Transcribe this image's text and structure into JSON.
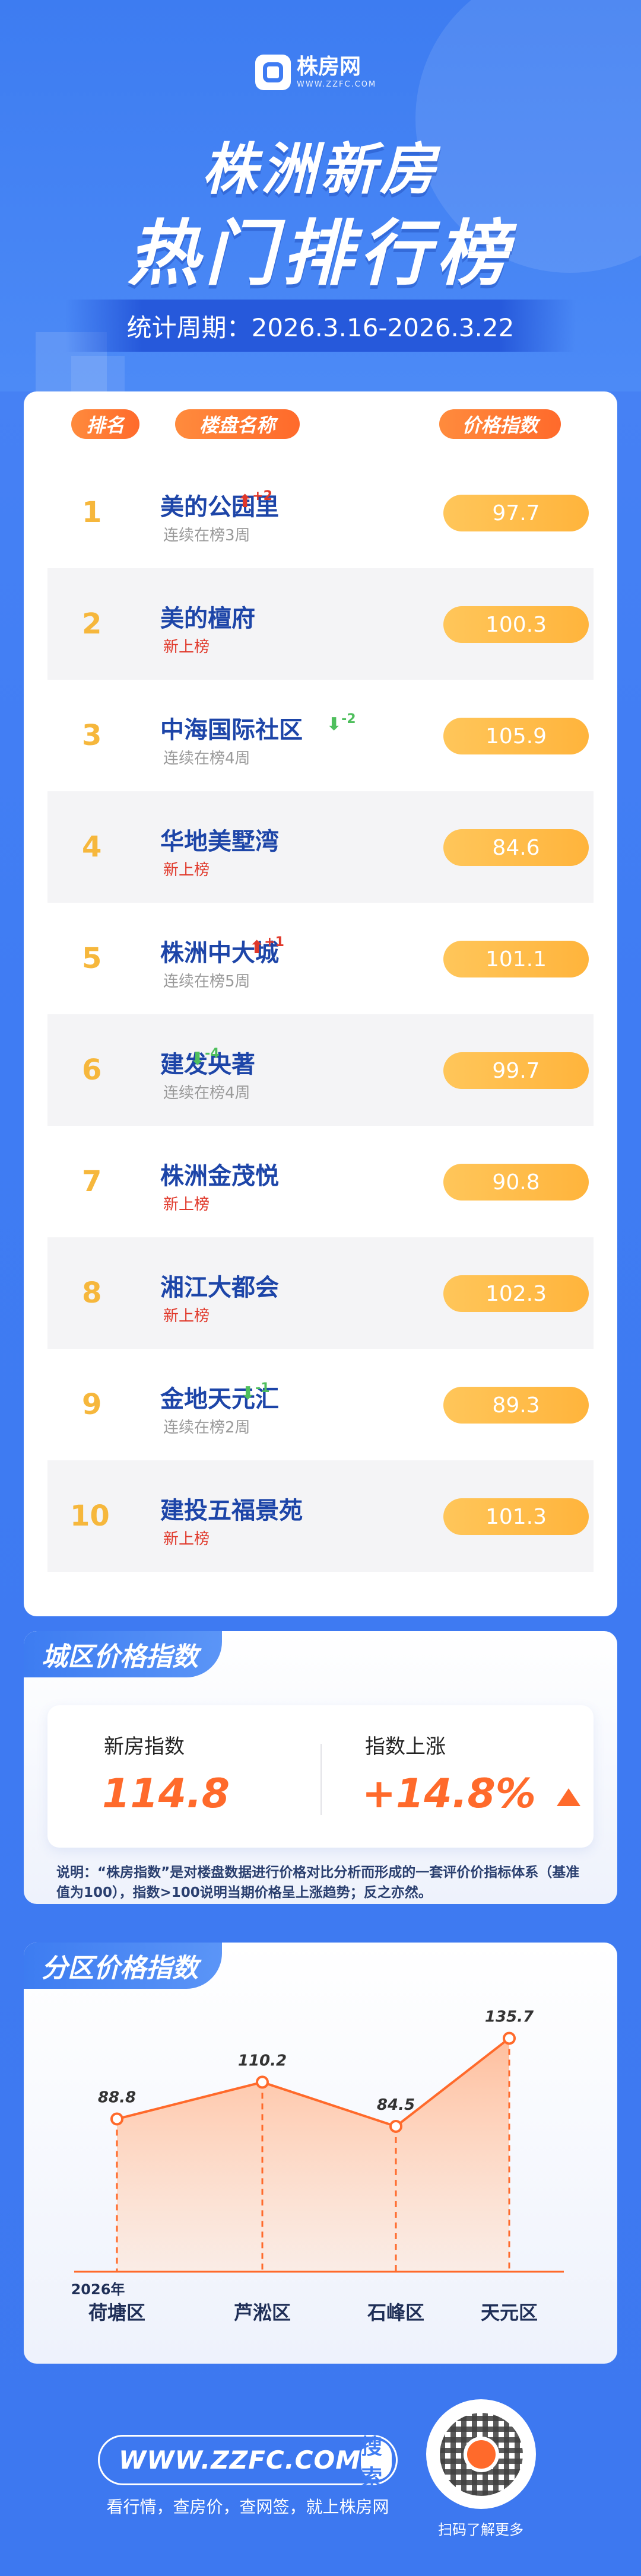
{
  "brand": {
    "name": "株房网",
    "domain": "WWW.ZZFC.COM"
  },
  "header": {
    "title_line1": "株洲新房",
    "title_line2": "热门排行榜",
    "period": "统计周期：2026.3.16-2026.3.22"
  },
  "ranking": {
    "headers": {
      "rank": "排名",
      "name": "楼盘名称",
      "price": "价格指数"
    },
    "rows": [
      {
        "rank": "1",
        "name": "美的公园里",
        "trend": "up",
        "delta": "+2",
        "status": "连续在榜3周",
        "status_type": "continuing",
        "price": "97.7"
      },
      {
        "rank": "2",
        "name": "美的檀府",
        "trend": "",
        "delta": "",
        "status": "新上榜",
        "status_type": "new",
        "price": "100.3"
      },
      {
        "rank": "3",
        "name": "中海国际社区",
        "trend": "down",
        "delta": "-2",
        "status": "连续在榜4周",
        "status_type": "continuing",
        "price": "105.9"
      },
      {
        "rank": "4",
        "name": "华地美墅湾",
        "trend": "",
        "delta": "",
        "status": "新上榜",
        "status_type": "new",
        "price": "84.6"
      },
      {
        "rank": "5",
        "name": "株洲中大城",
        "trend": "up",
        "delta": "+1",
        "status": "连续在榜5周",
        "status_type": "continuing",
        "price": "101.1"
      },
      {
        "rank": "6",
        "name": "建发央著",
        "trend": "down",
        "delta": "-4",
        "status": "连续在榜4周",
        "status_type": "continuing",
        "price": "99.7"
      },
      {
        "rank": "7",
        "name": "株洲金茂悦",
        "trend": "",
        "delta": "",
        "status": "新上榜",
        "status_type": "new",
        "price": "90.8"
      },
      {
        "rank": "8",
        "name": "湘江大都会",
        "trend": "",
        "delta": "",
        "status": "新上榜",
        "status_type": "new",
        "price": "102.3"
      },
      {
        "rank": "9",
        "name": "金地天元汇",
        "trend": "down",
        "delta": "-1",
        "status": "连续在榜2周",
        "status_type": "continuing",
        "price": "89.3"
      },
      {
        "rank": "10",
        "name": "建投五福景苑",
        "trend": "",
        "delta": "",
        "status": "新上榜",
        "status_type": "new",
        "price": "101.3"
      }
    ]
  },
  "city_index": {
    "section_title": "城区价格指数",
    "label_index": "新房指数",
    "value_index": "114.8",
    "label_rise": "指数上涨",
    "value_rise": "+14.8%",
    "note": "说明：“株房指数”是对楼盘数据进行价格对比分析而形成的一套评价价指标体系（基准值为100），指数>100说明当期价格呈上涨趋势；反之亦然。"
  },
  "district_index": {
    "section_title": "分区价格指数",
    "year_label": "2026年"
  },
  "chart_data": {
    "type": "area",
    "categories": [
      "荷塘区",
      "芦淞区",
      "石峰区",
      "天元区"
    ],
    "values": [
      88.8,
      110.2,
      84.5,
      135.7
    ],
    "value_labels": [
      "88.8",
      "110.2",
      "84.5",
      "135.7"
    ],
    "title": "分区价格指数",
    "xlabel": "2026年",
    "ylabel": "",
    "ylim": [
      0,
      150
    ],
    "grid": false,
    "colors": {
      "line": "#ff6a2b",
      "fill": "#ffb893"
    }
  },
  "footer": {
    "search_label": "搜索",
    "tagline": "看行情，查房价，查网签，就上株房网",
    "qr_caption": "扫码了解更多"
  },
  "icons": {
    "up": "arrow-up-icon",
    "down": "arrow-down-icon",
    "rise": "triangle-up-icon",
    "search": "search-icon",
    "logo": "zzfc-logo-icon",
    "qr": "qr-code-icon"
  },
  "colors": {
    "primary": "#3f7cf3",
    "accent": "#ff6a2b",
    "gold": "#f6b73c",
    "name_blue": "#1d45a8",
    "new_red": "#e0382a",
    "down_green": "#4fbf5d"
  }
}
